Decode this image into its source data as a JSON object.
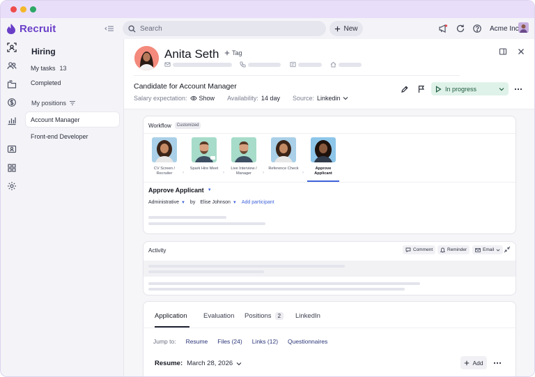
{
  "app": {
    "name": "Recruit",
    "org_name": "Acme Inc"
  },
  "topbar": {
    "search_placeholder": "Search",
    "new_label": "New"
  },
  "sidebar": {
    "title": "Hiring",
    "my_tasks_label": "My tasks",
    "my_tasks_count": "13",
    "completed_label": "Completed",
    "my_positions_label": "My positions",
    "positions": [
      "Account Manager",
      "Front-end Developer"
    ]
  },
  "candidate": {
    "name": "Anita Seth",
    "tag_label": "Tag",
    "role_prefix": "Candidate for",
    "role": "Account Manager",
    "salary_label": "Salary expectation:",
    "salary_value": "Show",
    "availability_label": "Availability:",
    "availability_value": "14 day",
    "source_label": "Source:",
    "source_value": "Linkedin",
    "status": "In progress"
  },
  "workflow": {
    "title": "Workflow",
    "badge": "Customized",
    "steps": [
      "CV Screen / Recruiter",
      "Spark Hire Meet",
      "Live Interview / Manager",
      "Reference Check",
      "Approve Applicant"
    ],
    "active_step_title": "Approve Applicant",
    "category": "Administrative",
    "by_label": "by",
    "assignee": "Elise Johnson",
    "add_participant": "Add participant"
  },
  "activity": {
    "title": "Activity",
    "comment": "Comment",
    "reminder": "Reminder",
    "email": "Email"
  },
  "application": {
    "tabs": [
      {
        "label": "Application"
      },
      {
        "label": "Evaluation"
      },
      {
        "label": "Positions",
        "count": "2"
      },
      {
        "label": "LinkedIn"
      }
    ],
    "jump_to": "Jump to:",
    "jump_links": [
      "Resume",
      "Files (24)",
      "Links (12)",
      "Questionnaires"
    ],
    "resume_label": "Resume:",
    "resume_date": "March 28, 2026",
    "add_label": "Add"
  },
  "colors": {
    "brand": "#6a3fc8",
    "accent_link": "#3f63d9",
    "status_bg": "#dff2e9",
    "status_text": "#1f5a3e",
    "titlebar": "#e9defa"
  },
  "icons": [
    "recruit-logo-icon",
    "collapse-sidebar-icon",
    "search-icon",
    "plus-icon",
    "megaphone-icon",
    "refresh-icon",
    "help-icon",
    "panel-icon",
    "close-icon",
    "pencil-icon",
    "flag-icon",
    "play-icon",
    "chevron-down-icon",
    "more-icon",
    "eye-icon",
    "mail-icon",
    "phone-icon",
    "id-card-icon",
    "home-icon",
    "expand-icon"
  ]
}
